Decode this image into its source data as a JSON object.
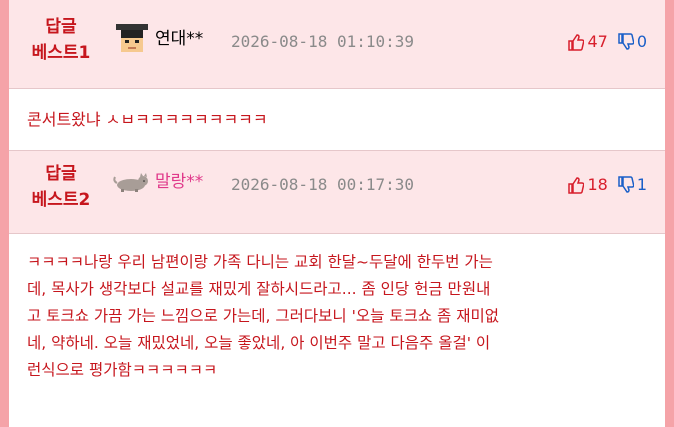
{
  "colors": {
    "outer_border": "#f5a3a8",
    "header_bg": "#fde6e8",
    "badge_text": "#c6161d",
    "content_text": "#c6161d",
    "up_count": "#d81f2c",
    "down_count": "#1a5fc8",
    "user_pink": "#e0398a",
    "date_gray": "#8a8a8a"
  },
  "replies": [
    {
      "badge_line1": "답글",
      "badge_line2": "베스트1",
      "avatar_icon": "grad-cap-avatar-icon",
      "username": "연대**",
      "username_color": "#222222",
      "date": "2026-08-18 01:10:39",
      "up": "47",
      "down": "0",
      "lines": [
        "콘서트왔냐 ㅅㅂㅋㅋㅋㅋㅋㅋㅋㅋㅋ"
      ]
    },
    {
      "badge_line1": "답글",
      "badge_line2": "베스트2",
      "avatar_icon": "cat-avatar-icon",
      "username": "말랑**",
      "username_color": "#e0398a",
      "date": "2026-08-18 00:17:30",
      "up": "18",
      "down": "1",
      "lines": [
        "ㅋㅋㅋㅋ나랑 우리 남편이랑 가족 다니는 교회 한달~두달에 한두번 가는",
        "데, 목사가 생각보다 설교를 재밌게 잘하시드라고... 좀 인당 헌금 만원내",
        "고 토크쇼 가끔 가는 느낌으로 가는데, 그러다보니 '오늘 토크쇼 좀 재미없",
        "네, 약하네. 오늘 재밌었네, 오늘 좋았네, 아 이번주 말고 다음주 올걸' 이",
        "런식으로 평가함ㅋㅋㅋㅋㅋㅋ"
      ]
    }
  ]
}
